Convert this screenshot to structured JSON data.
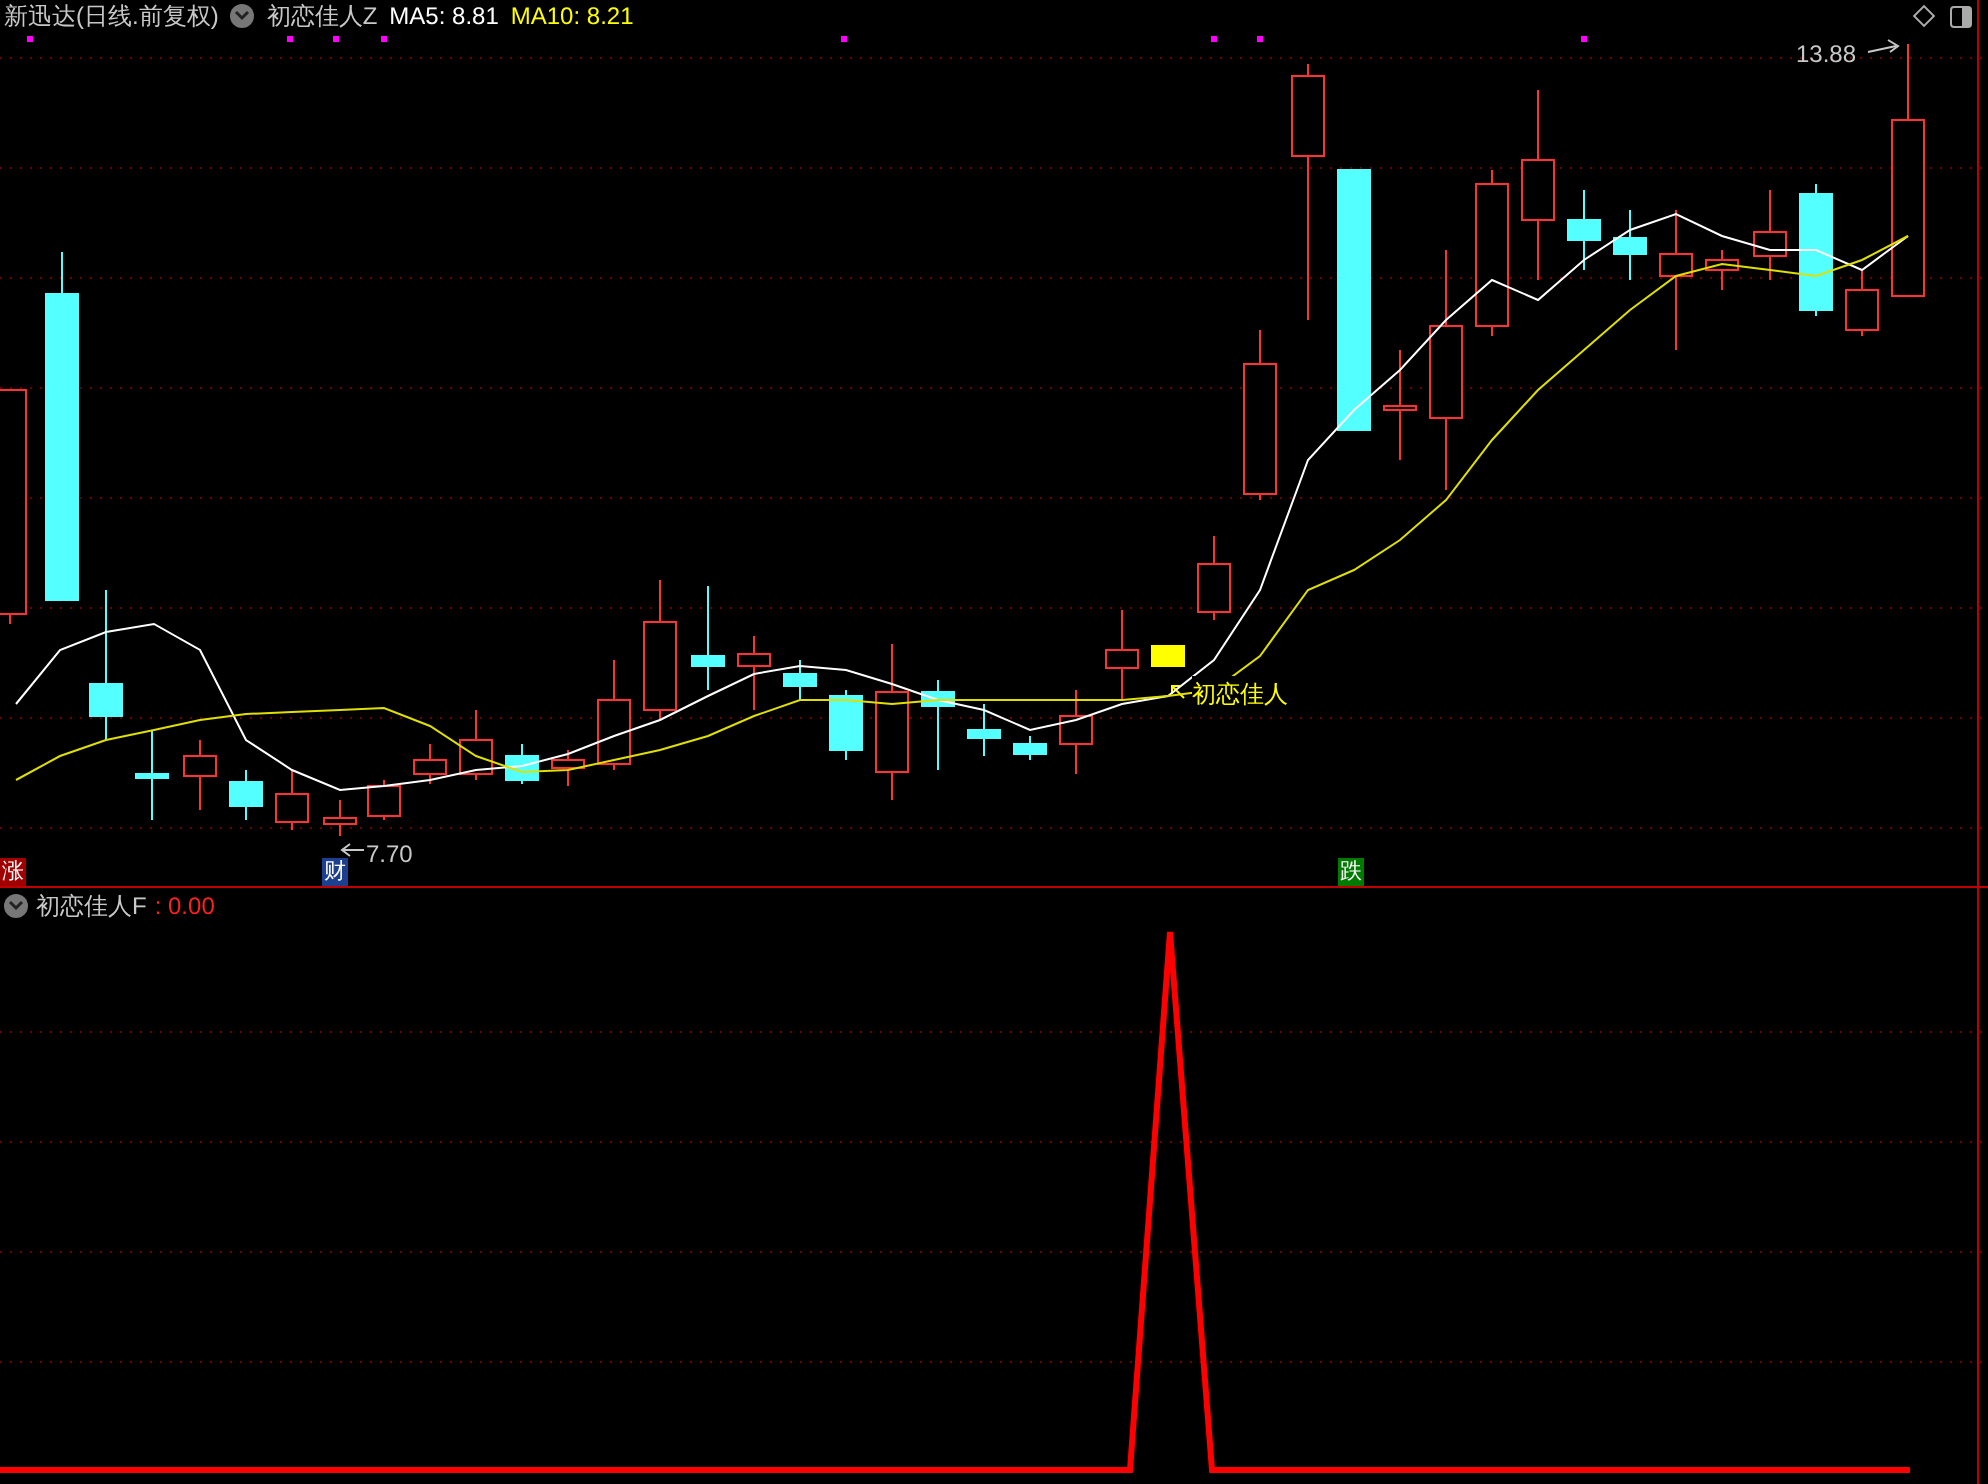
{
  "main_panel": {
    "title": "新迅达(日线.前复权)",
    "indicator": "初恋佳人Z",
    "averages": [
      {
        "label": "MA5: 8.81",
        "color": "#ffffff"
      },
      {
        "label": "MA10: 8.21",
        "color": "#ffff00"
      }
    ],
    "high_label": "13.88",
    "low_label": "7.70",
    "signal_label": "初恋佳人",
    "markers": [
      {
        "text": "涨",
        "kind": "rise"
      },
      {
        "text": "财",
        "kind": "finance"
      },
      {
        "text": "跌",
        "kind": "fall"
      }
    ]
  },
  "sub_panel": {
    "indicator": "初恋佳人F",
    "value": ": 0.00"
  }
}
